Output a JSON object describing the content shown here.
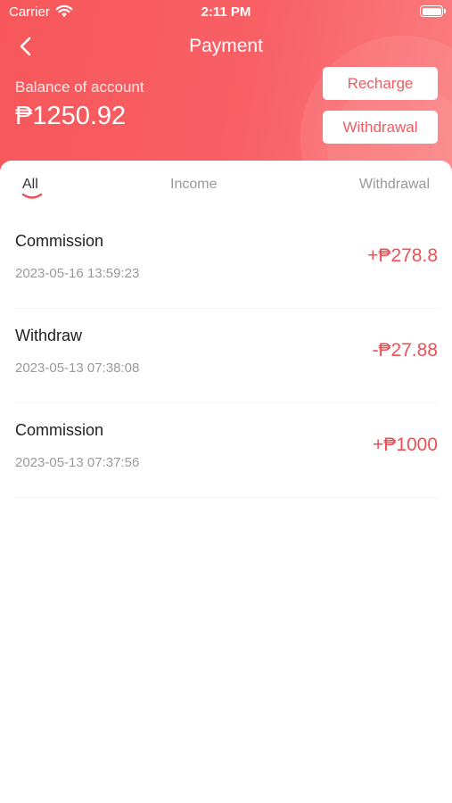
{
  "status_bar": {
    "carrier": "Carrier",
    "time": "2:11 PM"
  },
  "nav": {
    "title": "Payment"
  },
  "balance": {
    "label": "Balance of account",
    "value": "₱1250.92"
  },
  "actions": {
    "recharge": "Recharge",
    "withdrawal": "Withdrawal"
  },
  "tabs": [
    {
      "label": "All",
      "active": true
    },
    {
      "label": "Income",
      "active": false
    },
    {
      "label": "Withdrawal",
      "active": false
    }
  ],
  "transactions": [
    {
      "title": "Commission",
      "time": "2023-05-16 13:59:23",
      "amount": "+₱278.8"
    },
    {
      "title": "Withdraw",
      "time": "2023-05-13 07:38:08",
      "amount": "-₱27.88"
    },
    {
      "title": "Commission",
      "time": "2023-05-13 07:37:56",
      "amount": "+₱1000"
    }
  ],
  "colors": {
    "header_gradient_start": "#f7575a",
    "accent": "#ee4f55",
    "white": "#ffffff"
  }
}
